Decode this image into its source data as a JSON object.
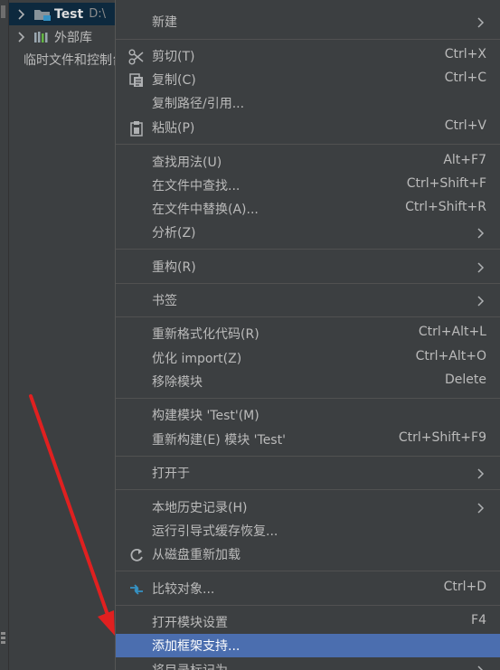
{
  "tree": [
    {
      "label": "Test",
      "path": "D:\\",
      "icon": "folder-module-icon",
      "selected": true
    },
    {
      "label": "外部库",
      "path": "",
      "icon": "library-icon",
      "selected": false
    },
    {
      "label": "临时文件和控制台",
      "path": "",
      "icon": "scratch-icon",
      "selected": false
    }
  ],
  "menu": {
    "items": [
      {
        "label": "新建",
        "shortcut": "",
        "submenu": true,
        "icon": ""
      },
      {
        "label": "剪切(T)",
        "shortcut": "Ctrl+X",
        "submenu": false,
        "icon": "scissors-icon"
      },
      {
        "label": "复制(C)",
        "shortcut": "Ctrl+C",
        "submenu": false,
        "icon": "copy-icon"
      },
      {
        "label": "复制路径/引用...",
        "shortcut": "",
        "submenu": false,
        "icon": ""
      },
      {
        "label": "粘贴(P)",
        "shortcut": "Ctrl+V",
        "submenu": false,
        "icon": "paste-icon"
      },
      {
        "label": "查找用法(U)",
        "shortcut": "Alt+F7",
        "submenu": false,
        "icon": ""
      },
      {
        "label": "在文件中查找...",
        "shortcut": "Ctrl+Shift+F",
        "submenu": false,
        "icon": ""
      },
      {
        "label": "在文件中替换(A)...",
        "shortcut": "Ctrl+Shift+R",
        "submenu": false,
        "icon": ""
      },
      {
        "label": "分析(Z)",
        "shortcut": "",
        "submenu": true,
        "icon": ""
      },
      {
        "label": "重构(R)",
        "shortcut": "",
        "submenu": true,
        "icon": ""
      },
      {
        "label": "书签",
        "shortcut": "",
        "submenu": true,
        "icon": ""
      },
      {
        "label": "重新格式化代码(R)",
        "shortcut": "Ctrl+Alt+L",
        "submenu": false,
        "icon": ""
      },
      {
        "label": "优化 import(Z)",
        "shortcut": "Ctrl+Alt+O",
        "submenu": false,
        "icon": ""
      },
      {
        "label": "移除模块",
        "shortcut": "Delete",
        "submenu": false,
        "icon": ""
      },
      {
        "label": "构建模块 'Test'(M)",
        "shortcut": "",
        "submenu": false,
        "icon": ""
      },
      {
        "label": "重新构建(E) 模块 'Test'",
        "shortcut": "Ctrl+Shift+F9",
        "submenu": false,
        "icon": ""
      },
      {
        "label": "打开于",
        "shortcut": "",
        "submenu": true,
        "icon": ""
      },
      {
        "label": "本地历史记录(H)",
        "shortcut": "",
        "submenu": true,
        "icon": ""
      },
      {
        "label": "运行引导式缓存恢复...",
        "shortcut": "",
        "submenu": false,
        "icon": ""
      },
      {
        "label": "从磁盘重新加载",
        "shortcut": "",
        "submenu": false,
        "icon": "reload-icon"
      },
      {
        "label": "比较对象...",
        "shortcut": "Ctrl+D",
        "submenu": false,
        "icon": "compare-icon"
      },
      {
        "label": "打开模块设置",
        "shortcut": "F4",
        "submenu": false,
        "icon": ""
      },
      {
        "label": "添加框架支持...",
        "shortcut": "",
        "submenu": false,
        "icon": "",
        "highlighted": true
      },
      {
        "label": "将目录标记为",
        "shortcut": "",
        "submenu": true,
        "icon": ""
      }
    ]
  },
  "colors": {
    "menu_bg": "#3c3f41",
    "highlight": "#4b6eaf",
    "tree_selected": "#0d293e",
    "annotation_arrow": "#e02020"
  }
}
